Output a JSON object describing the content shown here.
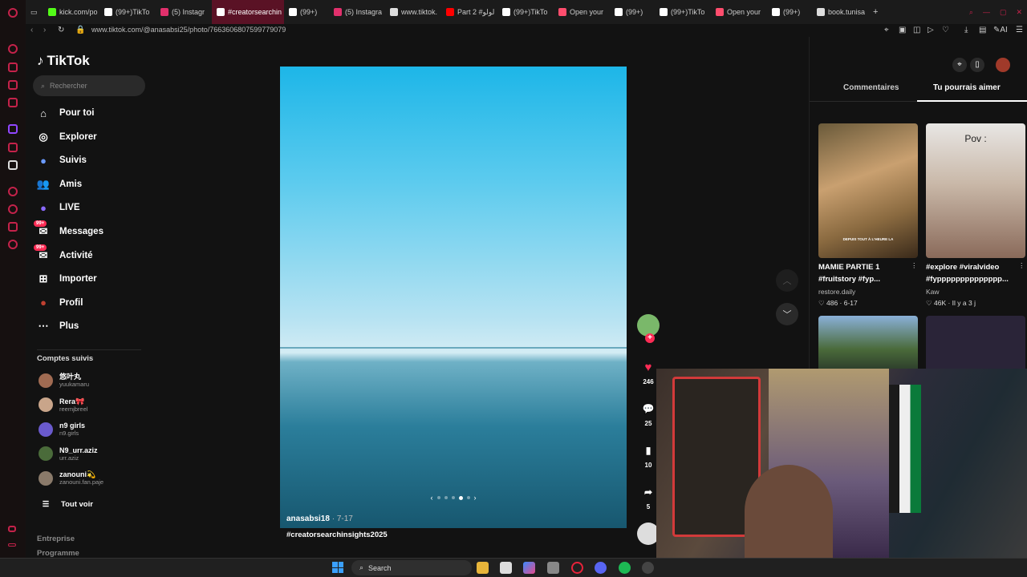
{
  "browser": {
    "tabs": [
      {
        "label": "kick.com/po",
        "color": "#53fc18"
      },
      {
        "label": "(99+)TikTo",
        "color": "#ffffff"
      },
      {
        "label": "(5) Instagr",
        "color": "#e1306c"
      },
      {
        "label": "#creatorsearchin",
        "color": "#ffffff",
        "active": true
      },
      {
        "label": "(99+)",
        "color": "#ffffff"
      },
      {
        "label": "(5) Instagra",
        "color": "#e1306c"
      },
      {
        "label": "www.tiktok.",
        "color": "#dddddd"
      },
      {
        "label": "Part 2 #لولو",
        "color": "#ff0000"
      },
      {
        "label": "(99+)TikTo",
        "color": "#ffffff"
      },
      {
        "label": "Open your",
        "color": "#ff4d6d"
      },
      {
        "label": "(99+)",
        "color": "#ffffff"
      },
      {
        "label": "(99+)TikTo",
        "color": "#ffffff"
      },
      {
        "label": "Open your",
        "color": "#ff4d6d"
      },
      {
        "label": "(99+)",
        "color": "#ffffff"
      },
      {
        "label": "book.tunisa",
        "color": "#dddddd"
      }
    ],
    "url": "www.tiktok.com/@anasabsi25/photo/7663606807599779079",
    "accent": "#c4224a"
  },
  "tiktok": {
    "logo": "TikTok",
    "search_placeholder": "Rechercher",
    "nav": [
      {
        "label": "Pour toi",
        "icon": "home-icon"
      },
      {
        "label": "Explorer",
        "icon": "compass-icon"
      },
      {
        "label": "Suivis",
        "icon": "following-avatar"
      },
      {
        "label": "Amis",
        "icon": "friends-icon"
      },
      {
        "label": "LIVE",
        "icon": "live-avatar"
      },
      {
        "label": "Messages",
        "icon": "messages-icon",
        "badge": "99+"
      },
      {
        "label": "Activité",
        "icon": "activity-icon",
        "badge": "99+"
      },
      {
        "label": "Importer",
        "icon": "upload-icon"
      },
      {
        "label": "Profil",
        "icon": "profile-avatar"
      },
      {
        "label": "Plus",
        "icon": "more-icon"
      }
    ],
    "following_title": "Comptes suivis",
    "following": [
      {
        "name": "悠叶丸",
        "handle": "yuukamaru",
        "color": "#a06b52"
      },
      {
        "name": "Rera🎀",
        "handle": "reemjbreel",
        "color": "#c9a58a"
      },
      {
        "name": "n9 girls",
        "handle": "n9.girls",
        "color": "#6a5acd"
      },
      {
        "name": "N9_urr.aziz",
        "handle": "urr.aziz",
        "color": "#4a6b3a"
      },
      {
        "name": "zanouni💫",
        "handle": "zanouni.fan.paje",
        "color": "#8a7a6a"
      }
    ],
    "see_all": "Tout voir",
    "footer": [
      "Entreprise",
      "Programme"
    ]
  },
  "post": {
    "author": "anasabsi18",
    "date": "7-17",
    "caption": "#creatorsearchinsights2025",
    "slide_prev": "‹",
    "slide_next": "›",
    "likes": "246",
    "comments": "25",
    "saves": "10",
    "shares": "5"
  },
  "right_panel": {
    "tabs": [
      "Commentaires",
      "Tu pourrais aimer"
    ],
    "videos": [
      {
        "title": "MAMIE PARTIE 1 #fruitstory #fyp...",
        "user": "restore.daily",
        "meta": "486 · 6-17",
        "thumb_text": "DEPUIS TOUT À L'HEURE LA"
      },
      {
        "title": "#explore #viralvideo #fypppppppppppppp...",
        "user": "Kaw",
        "meta": "46K · Il y a 3 j",
        "thumb_text": "Pov :"
      }
    ]
  },
  "taskbar": {
    "search_label": "Search"
  }
}
